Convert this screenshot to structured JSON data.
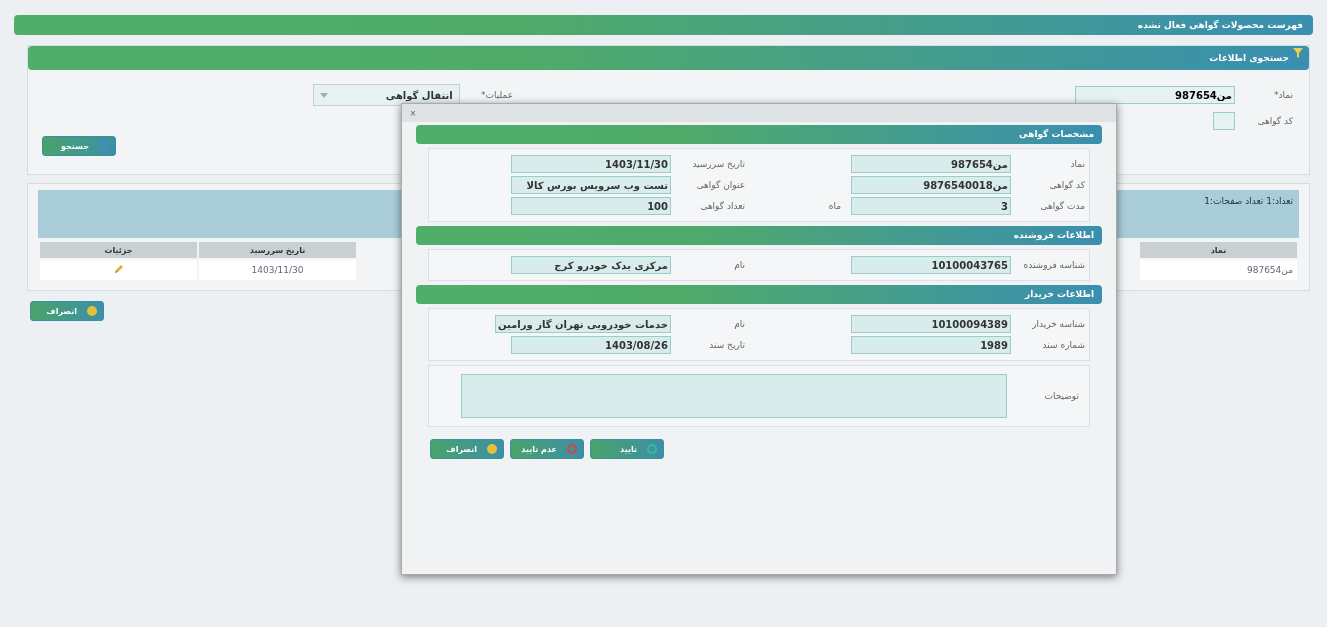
{
  "page_title": "فهرست محصولات گواهی فعال نشده",
  "search": {
    "title": "جستجوی اطلاعات",
    "fields": [
      {
        "kind": "text",
        "label": "نماد*",
        "value": "من987654"
      },
      {
        "kind": "text",
        "label": "کد گواهی"
      },
      {
        "kind": "select",
        "label": "عملیات*",
        "value": "انتقال گواهی"
      }
    ],
    "button": "جستجو"
  },
  "results": {
    "summary": "تعداد:1 تعداد صفحات:1",
    "columns": [
      "نماد",
      "تاریخ سررسید",
      "جزئیات"
    ],
    "rows": [
      {
        "cells": [
          "من987654",
          "1403/11/30"
        ]
      }
    ]
  },
  "cancel_button": "انصراف",
  "dialog": {
    "close": "×",
    "sections": [
      {
        "title": "مشخصات گواهی",
        "fields": [
          {
            "label": "نماد",
            "value": "من987654"
          },
          {
            "label": "تاریخ سررسید",
            "value": "1403/11/30"
          },
          {
            "label": "کد گواهی",
            "value": "من9876540018"
          },
          {
            "label": "عنوان گواهی",
            "value": "تست وب سرویس بورس کالا"
          },
          {
            "label": "مدت گواهی",
            "value": "3",
            "unit": "ماه"
          },
          {
            "label": "تعداد گواهی",
            "value": "100"
          }
        ]
      },
      {
        "title": "اطلاعات فروشنده",
        "fields": [
          {
            "label": "شناسه فروشنده",
            "value": "10100043765"
          },
          {
            "label": "نام",
            "value": "مرکزی یدک خودرو کرج"
          }
        ]
      },
      {
        "title": "اطلاعات خریدار",
        "fields": [
          {
            "label": "شناسه خریدار",
            "value": "10100094389"
          },
          {
            "label": "نام",
            "value": "خدمات خودرویی تهران گاز ورامین"
          },
          {
            "label": "شماره سند",
            "value": "1989"
          },
          {
            "label": "تاریخ سند",
            "value": "1403/08/26"
          }
        ]
      }
    ],
    "description": {
      "label": "توضیحات"
    },
    "buttons": [
      {
        "kind": "confirm",
        "label": "تایید"
      },
      {
        "kind": "reject",
        "label": "عدم تایید"
      },
      {
        "kind": "cancel",
        "label": "انصراف"
      }
    ]
  }
}
